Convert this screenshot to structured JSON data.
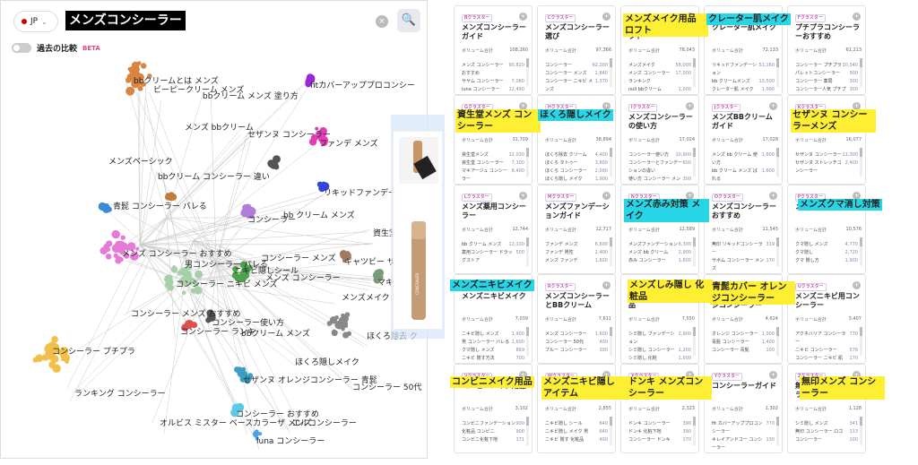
{
  "search": {
    "country": "JP",
    "query": "メンズコンシーラー",
    "clear_icon": "×",
    "search_icon": "🔍"
  },
  "compare": {
    "toggle_label": "OFF",
    "label": "過去の比較",
    "beta": "BETA"
  },
  "graph": {
    "labels": [
      "bbクリームとは メンズ",
      "ビーピークリーム メンズ",
      "bbクリーム メンズ 塗り方",
      "fitカバーアッププロコンシー",
      "メンズ bbクリーム",
      "セザンヌ コンシーラー",
      "ファンデ メンズ",
      "メンズベーシック",
      "bbクリーム コンシーラー 違い",
      "リキッドファンデー",
      "青髭 コンシーラー バレる",
      "bb クリーム メンズ",
      "コンシーラー",
      "資生堂メ",
      "メンズ コンシーラー おすすめ",
      "コンシーラー メンズ",
      "男コンシーラー バレる",
      "ギャツビー ザ デザ",
      "ニキビ隠しシール",
      "メンズ コンシーラー",
      "マキアー",
      "メンズメイク",
      "コンシーラー ニキビ メンズ",
      "コンシーラー メンズ おすすめ",
      "コンシーラー使い方",
      "コンシーラー ランキ",
      "bbクリーム メンズ",
      "ほくろ除去 ク",
      "コンシーラー プチプラ",
      "ほくろ隠しメイク",
      "セザンヌ オレンジコンシーラー 青髭",
      "コンシーラー 50代",
      "ランキング コンシーラー",
      "コンシーラー おすすめ",
      "オルビス ミスター ベースカラーザ メンズ",
      "エルコンシーラー",
      "luna コンシーラー"
    ]
  },
  "cards": [
    {
      "tag": "Bクラスター",
      "title": "メンズコンシーラーガイド",
      "volume": "108,260",
      "rows": [
        [
          "メンズ コンシーラー おすすめ",
          "90,820"
        ],
        [
          "サヤム コンシーラー",
          "7,060"
        ],
        [
          "luna コンシーラー",
          "12,490"
        ]
      ]
    },
    {
      "tag": "Cクラスター",
      "title": "メンズコンシーラー選び",
      "volume": "97,366",
      "rows": [
        [
          "コンシーラー",
          "92,300"
        ],
        [
          "コンシーラー メンズ",
          "2,840"
        ],
        [
          "コンシーラー ニキビ メンズ",
          "1,370"
        ]
      ]
    },
    {
      "tag": "Dクラスター",
      "title": "メンズメイク用品ロフト",
      "volume": "78,043",
      "rows": [
        [
          "メンズメイク",
          "58,000"
        ],
        [
          "メンズ コンシーラー ランキング",
          "17,000"
        ],
        [
          "null bbクリーム",
          "1,000"
        ]
      ]
    },
    {
      "tag": "Eクラスター",
      "title": "クレーター肌メイク",
      "volume": "72,133",
      "rows": [
        [
          "リキッドファンデーション",
          "51,160"
        ],
        [
          "bb クリームメンズ",
          "13,500"
        ],
        [
          "クレーター肌 メイク",
          "1,090"
        ]
      ]
    },
    {
      "tag": "Fクラスター",
      "title": "プチプラコンシーラーおすすめ",
      "volume": "61,213",
      "rows": [
        [
          "コンシーラー プチプラ",
          "30,340"
        ],
        [
          "パレットコンシーラー",
          "900"
        ],
        [
          "コンシーラー 薬局",
          "300"
        ],
        [
          "コンシーラー人気 プチプラ",
          "300"
        ]
      ]
    },
    {
      "tag": "Gクラスター",
      "title": "資生堂メンズコンシーラー",
      "volume": "31,709",
      "rows": [
        [
          "資生堂メンズ",
          "12,030"
        ],
        [
          "資生堂 コンシーラー",
          "7,100"
        ],
        [
          "マキアージュ コンシーラー",
          "6,400"
        ]
      ]
    },
    {
      "tag": "Hクラスター",
      "title": "ほくろ隠しメイク",
      "volume": "38,894",
      "rows": [
        [
          "ほくろ除去 クリーム",
          "4,400"
        ],
        [
          "ほくろ タトゥー",
          "3,800"
        ],
        [
          "ほくろ コンシーラー",
          "2,090"
        ],
        [
          "ほくろ隠し メイク",
          "1,900"
        ]
      ]
    },
    {
      "tag": "Iクラスター",
      "title": "メンズコンシーラーの使い方",
      "volume": "17,024",
      "rows": [
        [
          "コンシーラー使い方",
          "10,900"
        ],
        [
          "コンシーラーとファンデーションの違い",
          "600"
        ],
        [
          "使い方 コンシーラー メンズ",
          "300"
        ]
      ]
    },
    {
      "tag": "Jクラスター",
      "title": "メンズBBクリームガイド",
      "volume": "17,028",
      "rows": [
        [
          "メンズ bb クリーム 使い方",
          "1,600"
        ],
        [
          "bb クリーム メンズ ばれる",
          "1,600"
        ]
      ]
    },
    {
      "tag": "Kクラスター",
      "title": "セザンヌコンシーラーメンズ",
      "volume": "16,077",
      "rows": [
        [
          "セザンヌ コンシーラー",
          "11,300"
        ],
        [
          "セザンヌ ストレッチコンシーラー",
          "2,400"
        ]
      ]
    },
    {
      "tag": "Lクラスター",
      "title": "メンズ薬用コンシーラー",
      "volume": "12,744",
      "rows": [
        [
          "bb クリーム メンズ",
          "12,100"
        ],
        [
          "薬用コンシーラー ドラッグストア",
          "500"
        ]
      ]
    },
    {
      "tag": "Mクラスター",
      "title": "メンズファンデーションガイド",
      "volume": "12,717",
      "rows": [
        [
          "ファンデ メンズ",
          "6,600"
        ],
        [
          "ファンデ 男性",
          "2,400"
        ],
        [
          "メンズ ファンデ",
          "1,600"
        ]
      ]
    },
    {
      "tag": "Nクラスター",
      "title": "メンズ赤み対策メイク",
      "volume": "12,589",
      "rows": [
        [
          "メンズファンデーション",
          "6,300"
        ],
        [
          "メンズ bb クリーム",
          "2,900"
        ],
        [
          "赤み コンシーラー",
          "1,600"
        ]
      ]
    },
    {
      "tag": "Oクラスター",
      "title": "メンズコンシーラーおすすめ",
      "volume": "11,545",
      "rows": [
        [
          "無印 リキッドコンシーラー",
          "319"
        ],
        [
          "サボム コンシーラー メンズ",
          "170"
        ]
      ]
    },
    {
      "tag": "Pクラスター",
      "title": "メンズクマ消し対策",
      "volume": "10,576",
      "rows": [
        [
          "クマ隠し メンズ",
          "4,770"
        ],
        [
          "クマ隠し",
          "2,720"
        ],
        [
          "クマ 隠し方",
          "1,900"
        ]
      ]
    },
    {
      "tag": "Qクラスター",
      "title": "メンズニキビメイク",
      "volume": "7,039",
      "rows": [
        [
          "ニキビ隠し メンズ",
          "1,900"
        ],
        [
          "男 コンシーラー バレる",
          "1,600"
        ],
        [
          "クマ隠し メンズ",
          "869"
        ],
        [
          "ニキビ 隠す方法",
          "700"
        ]
      ]
    },
    {
      "tag": "Rクラスター",
      "title": "メンズコンシーラーとBBクリーム",
      "volume": "7,611",
      "rows": [
        [
          "メンズ コンシーラー",
          "1,600"
        ],
        [
          "コンシーラー 50代",
          "400"
        ],
        [
          "ブルー コンシーラー",
          "300"
        ]
      ]
    },
    {
      "tag": "Sクラスター",
      "title": "メンズしみ隠し化粧品",
      "volume": "7,550",
      "rows": [
        [
          "シミ隠し ファンデーション",
          "2,900"
        ],
        [
          "シミ隠し コンシーラー",
          "1,200"
        ],
        [
          "シミ隠し 化粧",
          "1,600"
        ]
      ]
    },
    {
      "tag": "Tクラスター",
      "title": "青髭カバー オレンジコンシーラー",
      "volume": "4,624",
      "rows": [
        [
          "オレンジ コンシーラー",
          "1,000"
        ],
        [
          "青髭 コンシーラー",
          "1,400"
        ],
        [
          "コンシーラー 青髭",
          "100"
        ]
      ]
    },
    {
      "tag": "Uクラスター",
      "title": "メンズニキビ用コンシーラー",
      "volume": "3,407",
      "rows": [
        [
          "アクネバリア コンシーラー",
          "770"
        ],
        [
          "ニキビ コンシーラー",
          "576"
        ],
        [
          "コンシーラー ニキビ 肌",
          "170"
        ]
      ]
    },
    {
      "tag": "Vクラスター",
      "title": "コンビニメイク用品",
      "volume": "3,102",
      "rows": [
        [
          "コンビニファンデーション",
          "900"
        ],
        [
          "化粧品 コンビニ",
          "900"
        ],
        [
          "コンビニ化粧下地",
          "171"
        ]
      ]
    },
    {
      "tag": "Wクラスター",
      "title": "メンズニキビ隠しアイテム",
      "volume": "2,855",
      "rows": [
        [
          "ニキビ隠し シール",
          "640"
        ],
        [
          "ニキビ隠し メイク 男",
          "640"
        ],
        [
          "ニキビ 隠す 化粧品",
          "400"
        ]
      ]
    },
    {
      "tag": "Xクラスター",
      "title": "ドンキ メンズコンシーラー",
      "volume": "2,323",
      "rows": [
        [
          "ドンキ コンシーラー",
          "390"
        ],
        [
          "ドンキ 化粧下地",
          "390"
        ],
        [
          "コンシーラー ドンキ",
          "170"
        ]
      ]
    },
    {
      "tag": "Yクラスター",
      "title": "コンシーラーガイド",
      "volume": "1,302",
      "rows": [
        [
          "fit カバーアッププロコンシーラー",
          "770"
        ],
        [
          "キレイアンドコー コンシーラー",
          "130"
        ],
        [
          "パレット 使い方",
          "130"
        ]
      ]
    },
    {
      "tag": "Zクラスター",
      "title": "無印メンズコンシーラー",
      "volume": "1,128",
      "rows": [
        [
          "シミ隠し メンズ",
          "341"
        ],
        [
          "無印 コンシーラー ロゴ",
          "133"
        ],
        [
          "コンシーラー",
          "100"
        ]
      ]
    }
  ],
  "volume_label": "ボリューム合計",
  "overlays": [
    {
      "text": "メンズメイク用品 ロフト",
      "color": "yellow"
    },
    {
      "text": "クレーター肌メイク",
      "color": "cyan"
    },
    {
      "text": "資生堂メンズ コンシーラー",
      "color": "yellow"
    },
    {
      "text": "ほくろ隠しメイク",
      "color": "cyan"
    },
    {
      "text": "セザンヌ コンシーラーメンズ",
      "color": "yellow"
    },
    {
      "text": "メンズ赤み対策 メイク",
      "color": "cyan"
    },
    {
      "text": "メンズクマ消し対策",
      "color": "cyan"
    },
    {
      "text": "メンズニキビメイク",
      "color": "cyan"
    },
    {
      "text": "メンズしみ隠し 化粧品",
      "color": "yellow"
    },
    {
      "text": "青髭カバー オレンジコンシーラー",
      "color": "yellow"
    },
    {
      "text": "コンビニメイク用品",
      "color": "yellow"
    },
    {
      "text": "メンズニキビ隠し アイテム",
      "color": "yellow"
    },
    {
      "text": "ドンキ メンズコンシーラー",
      "color": "yellow"
    },
    {
      "text": "無印メンズ コンシーラー",
      "color": "yellow"
    }
  ],
  "graph_highlights": [
    {
      "text": "ほくろ隠しメイク"
    },
    {
      "text": "コンシーラー プチプラ"
    }
  ]
}
